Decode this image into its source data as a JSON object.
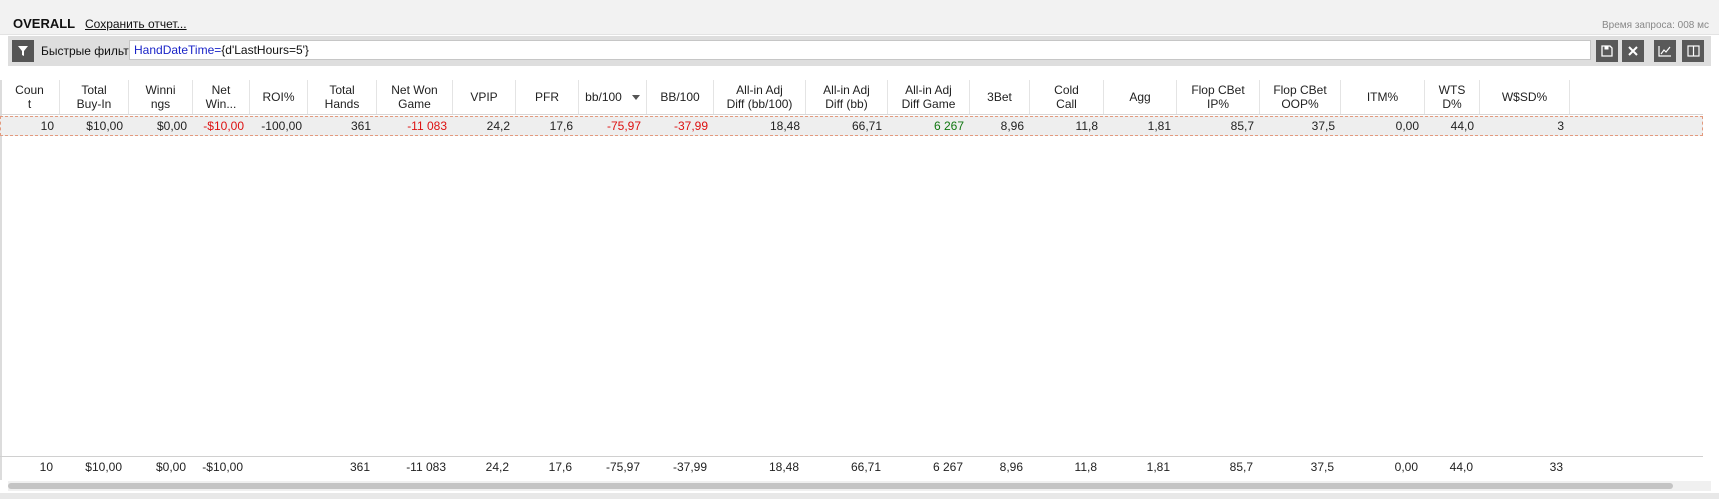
{
  "header": {
    "title": "OVERALL",
    "save_report": "Сохранить отчет...",
    "query_time": "Время запроса: 008 мс"
  },
  "filter": {
    "label": "Быстрые фильт",
    "expr_field": "HandDateTime",
    "expr_op": "=",
    "expr_value": "{d'LastHours=5'}"
  },
  "icons": {
    "filter": "filter-funnel-icon",
    "save": "floppy-disk-icon",
    "clear": "close-x-icon",
    "graph": "line-graph-icon",
    "columns": "split-columns-icon"
  },
  "colors": {
    "negative": "#dd1111",
    "positive": "#117711",
    "selection_border": "#e39a7e"
  },
  "table": {
    "columns": [
      "Coun\nt",
      "Total\nBuy-In",
      "Winni\nngs",
      "Net\nWin...",
      "ROI%",
      "Total\nHands",
      "Net Won\nGame",
      "VPIP",
      "PFR",
      "bb/100",
      "BB/100",
      "All-in Adj\nDiff (bb/100)",
      "All-in Adj\nDiff (bb)",
      "All-in Adj\nDiff Game",
      "3Bet",
      "Cold\nCall",
      "Agg",
      "Flop CBet\nIP%",
      "Flop CBet\nOOP%",
      "ITM%",
      "WTS\nD%",
      "W$SD%"
    ],
    "sorted_column": "bb/100",
    "rows": [
      [
        "10",
        "$10,00",
        "$0,00",
        "-$10,00",
        "-100,00",
        "361",
        "-11 083",
        "24,2",
        "17,6",
        "-75,97",
        "-37,99",
        "18,48",
        "66,71",
        "6 267",
        "8,96",
        "11,8",
        "1,81",
        "85,7",
        "37,5",
        "0,00",
        "44,0",
        "3"
      ]
    ],
    "totals": [
      "10",
      "$10,00",
      "$0,00",
      "-$10,00",
      "",
      "361",
      "-11 083",
      "24,2",
      "17,6",
      "-75,97",
      "-37,99",
      "18,48",
      "66,71",
      "6 267",
      "8,96",
      "11,8",
      "1,81",
      "85,7",
      "37,5",
      "0,00",
      "44,0",
      "33"
    ]
  }
}
